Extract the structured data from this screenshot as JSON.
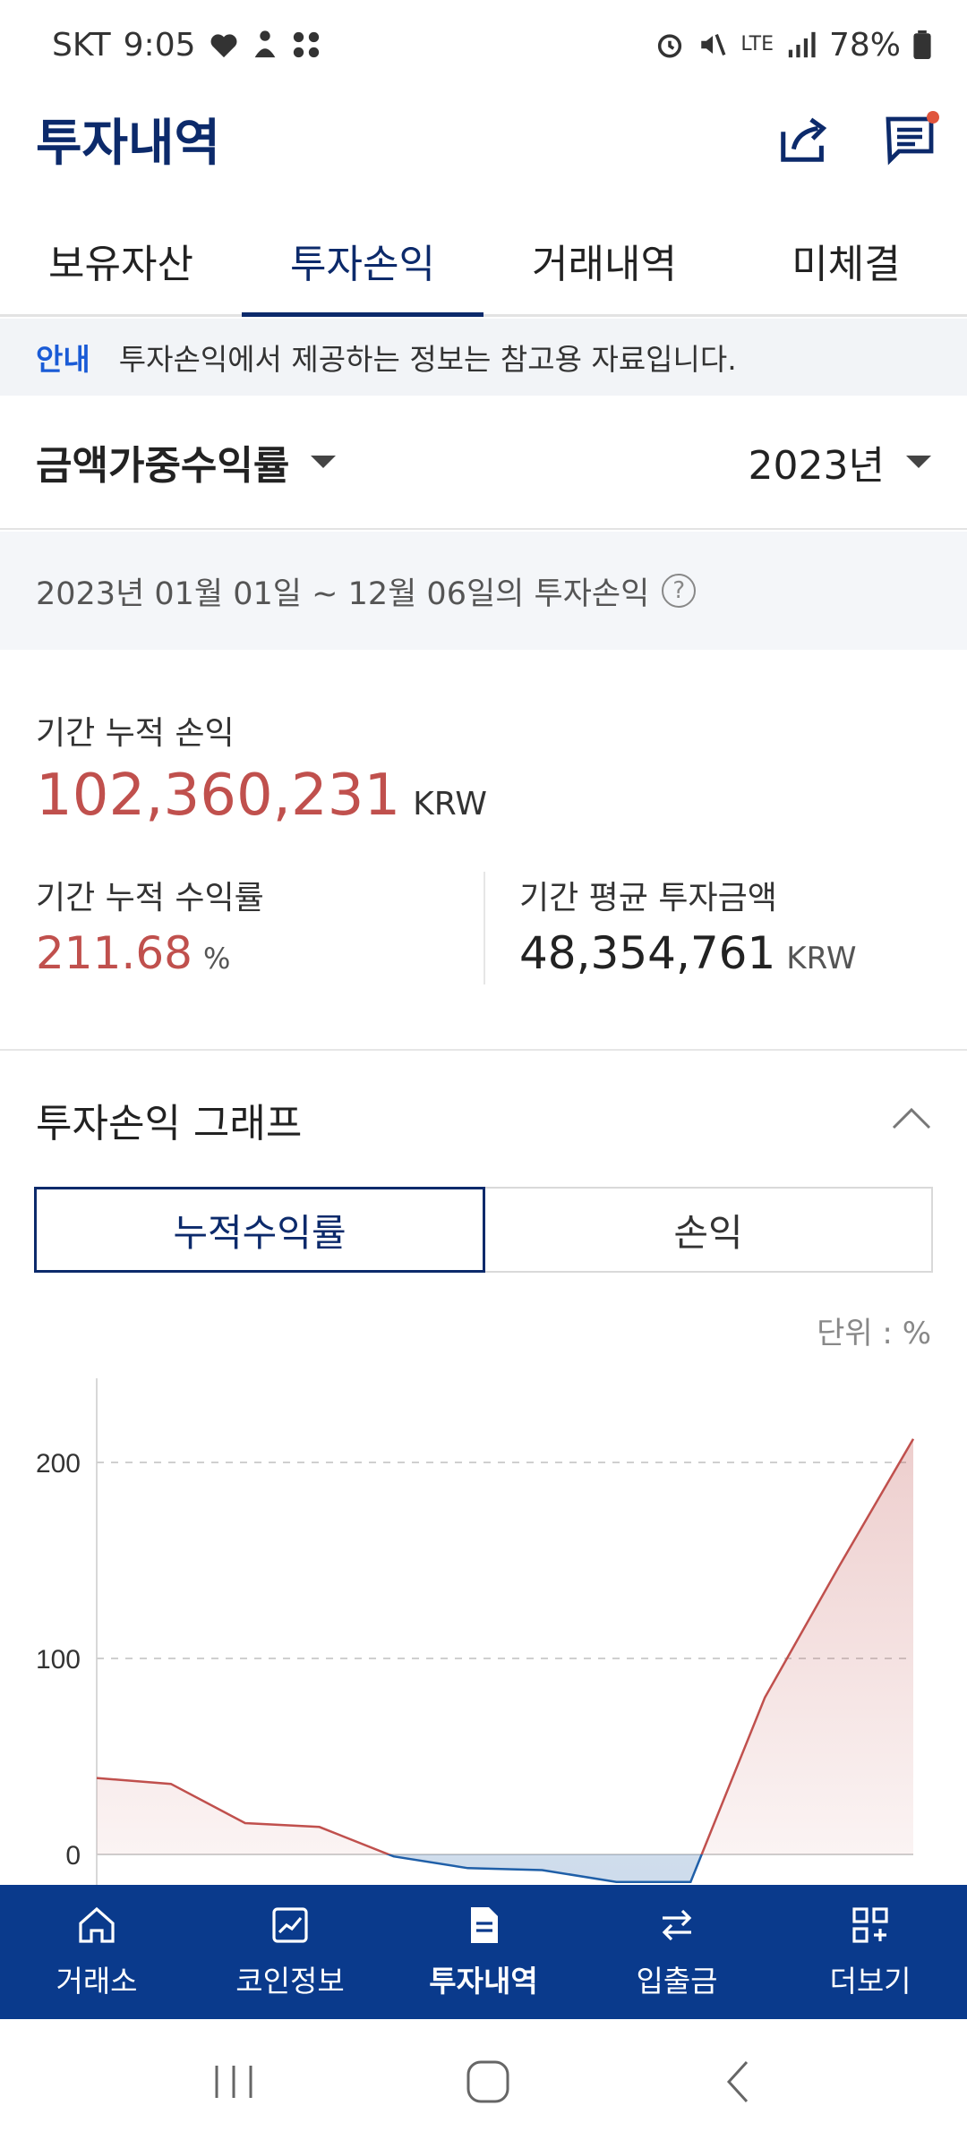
{
  "status_bar": {
    "carrier": "SKT",
    "time": "9:05",
    "battery": "78%",
    "network": "LTE"
  },
  "app_bar": {
    "title": "투자내역"
  },
  "tabs": [
    {
      "label": "보유자산",
      "active": false
    },
    {
      "label": "투자손익",
      "active": true
    },
    {
      "label": "거래내역",
      "active": false
    },
    {
      "label": "미체결",
      "active": false
    }
  ],
  "notice": {
    "label": "안내",
    "text": "투자손익에서 제공하는 정보는 참고용 자료입니다."
  },
  "selectors": {
    "metric": "금액가중수익률",
    "year": "2023년"
  },
  "period": {
    "text": "2023년 01월 01일 ~ 12월 06일의 투자손익"
  },
  "summary": {
    "cumulative_pnl_label": "기간 누적 손익",
    "cumulative_pnl_value": "102,360,231",
    "cumulative_pnl_unit": "KRW",
    "cumulative_rate_label": "기간 누적 수익률",
    "cumulative_rate_value": "211.68",
    "cumulative_rate_unit": "%",
    "avg_invest_label": "기간 평균 투자금액",
    "avg_invest_value": "48,354,761",
    "avg_invest_unit": "KRW"
  },
  "graph": {
    "title": "투자손익 그래프",
    "toggle": [
      "누적수익률",
      "손익"
    ],
    "active_toggle": 0,
    "unit_note": "단위 : %"
  },
  "chart_data": {
    "type": "area",
    "x": [
      1,
      2,
      3,
      4,
      5,
      6,
      7,
      8,
      9,
      10,
      11,
      12
    ],
    "values": [
      39,
      36,
      16,
      14,
      -1,
      -7,
      -8,
      -14,
      -14,
      80,
      147,
      212
    ],
    "yticks": [
      0,
      100,
      200
    ],
    "ylim": [
      -15,
      235
    ],
    "positive_color": "#c0504d",
    "negative_color": "#1f5fa8",
    "grid": true
  },
  "bottom_nav": [
    {
      "label": "거래소",
      "icon": "home-icon",
      "active": false
    },
    {
      "label": "코인정보",
      "icon": "chart-icon",
      "active": false
    },
    {
      "label": "투자내역",
      "icon": "document-icon",
      "active": true
    },
    {
      "label": "입출금",
      "icon": "transfer-icon",
      "active": false
    },
    {
      "label": "더보기",
      "icon": "more-grid-icon",
      "active": false
    }
  ],
  "colors": {
    "brand": "#0a3a8c",
    "title": "#0c2a6b",
    "profit": "#c0504d",
    "loss": "#1f5fa8"
  }
}
